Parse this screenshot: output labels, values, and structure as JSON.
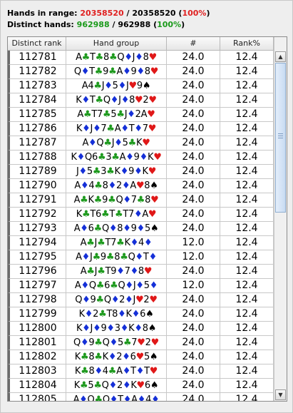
{
  "summary": {
    "hands_label": "Hands in range:",
    "hands_in_range": "20358520",
    "hands_total": "20358520",
    "hands_pct": "100%",
    "distinct_label": "Distinct hands:",
    "distinct_hands": "962988",
    "distinct_total": "962988",
    "distinct_pct": "100%"
  },
  "table": {
    "columns": [
      "Distinct rank",
      "Hand group",
      "#",
      "Rank%"
    ],
    "suit_symbols": {
      "c": "♣",
      "d": "♦",
      "h": "♥",
      "s": "♠"
    },
    "suit_colors": {
      "c": "#1e9a1e",
      "d": "#1530d8",
      "h": "#e01818",
      "s": "#000000"
    },
    "rows": [
      [
        "112781",
        "AcTc8cQdJd8h",
        "24.0",
        "12.4"
      ],
      [
        "112782",
        "QdTc9cAd9d8h",
        "24.0",
        "12.4"
      ],
      [
        "112783",
        "A4cJd5dJh9s",
        "24.0",
        "12.4"
      ],
      [
        "112784",
        "KdTcQdJd8h2h",
        "24.0",
        "12.4"
      ],
      [
        "112785",
        "AcT7c5cJd2Ah",
        "24.0",
        "12.4"
      ],
      [
        "112786",
        "KdJd7cAdTd7h",
        "24.0",
        "12.4"
      ],
      [
        "112787",
        "AdQcJd5cKh",
        "24.0",
        "12.4"
      ],
      [
        "112788",
        "KdQ6c3cAd9dKh",
        "24.0",
        "12.4"
      ],
      [
        "112789",
        "Jd5c3cKd9dKh",
        "24.0",
        "12.4"
      ],
      [
        "112790",
        "Ad4c8d2dAh8s",
        "24.0",
        "12.4"
      ],
      [
        "112791",
        "AcKc9cQd7c8h",
        "24.0",
        "12.4"
      ],
      [
        "112792",
        "KcT6cTcT7dAh",
        "24.0",
        "12.4"
      ],
      [
        "112793",
        "Ad6cQd8d9d5s",
        "24.0",
        "12.4"
      ],
      [
        "112794",
        "AcJcT7cKd4d",
        "12.0",
        "12.4"
      ],
      [
        "112795",
        "AdJc9c8cQdTd",
        "12.0",
        "12.4"
      ],
      [
        "112796",
        "AcJcT9d7d8h",
        "24.0",
        "12.4"
      ],
      [
        "112797",
        "AdQc6cQdJd5d",
        "12.0",
        "12.4"
      ],
      [
        "112798",
        "Qd9cQd2dJh2h",
        "24.0",
        "12.4"
      ],
      [
        "112799",
        "Kd2cT8dKd6s",
        "24.0",
        "12.4"
      ],
      [
        "112800",
        "KdJd9d3dKd8s",
        "24.0",
        "12.4"
      ],
      [
        "112801",
        "Qd9cQd5c7h2h",
        "24.0",
        "12.4"
      ],
      [
        "112802",
        "Kc8cKd2d6h5s",
        "24.0",
        "12.4"
      ],
      [
        "112803",
        "Kc8d4cAdTdTh",
        "24.0",
        "12.4"
      ],
      [
        "112804",
        "Kc5cQd2dKh6s",
        "24.0",
        "12.4"
      ],
      [
        "112805",
        "AdQcQdTdAd4d",
        "24.0",
        "12.4"
      ]
    ]
  }
}
